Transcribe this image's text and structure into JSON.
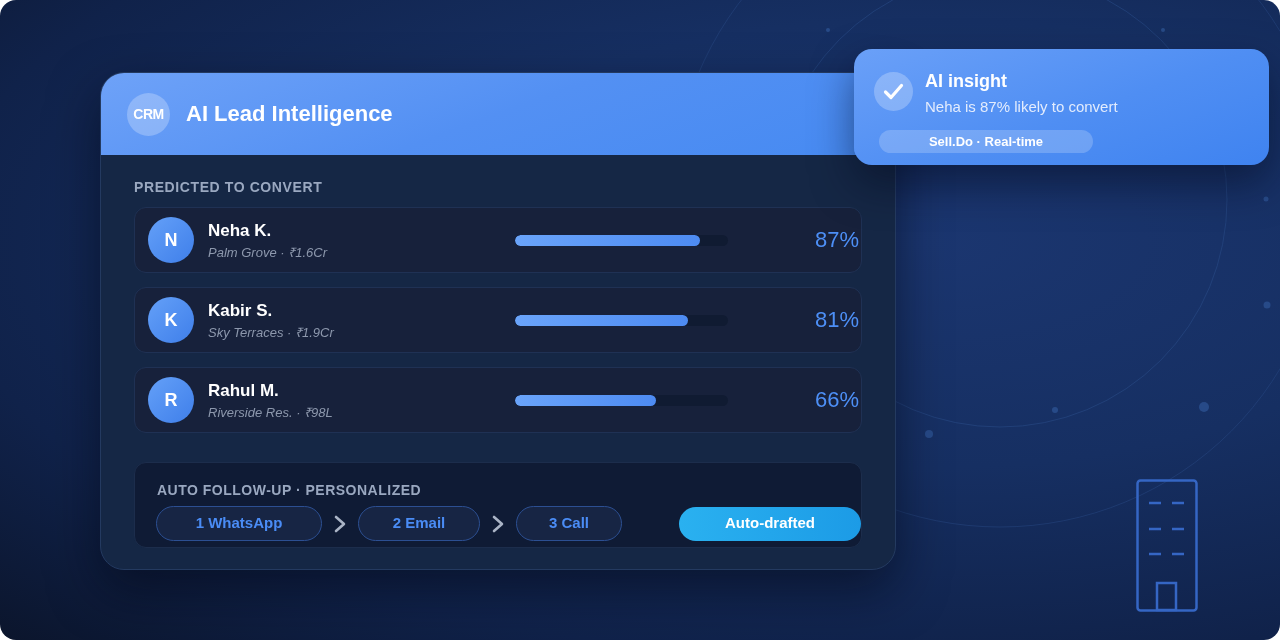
{
  "card": {
    "logo": "CRM",
    "title": "AI Lead Intelligence",
    "section_label": "PREDICTED TO CONVERT",
    "leads": [
      {
        "initial": "N",
        "name": "Neha K.",
        "detail": "Palm Grove · ₹1.6Cr",
        "level": 0.87,
        "score": "87%"
      },
      {
        "initial": "K",
        "name": "Kabir S.",
        "detail": "Sky Terraces · ₹1.9Cr",
        "level": 0.81,
        "score": "81%"
      },
      {
        "initial": "R",
        "name": "Rahul M.",
        "detail": "Riverside Res. · ₹98L",
        "level": 0.66,
        "score": "66%"
      }
    ]
  },
  "follow_up": {
    "label": "AUTO FOLLOW-UP · PERSONALIZED",
    "steps": [
      "1 WhatsApp",
      "2 Email",
      "3 Call"
    ],
    "status": "Auto-drafted"
  },
  "insight": {
    "title": "AI insight",
    "message": "Neha is 87% likely to convert",
    "tag": "Sell.Do · Real-time"
  }
}
